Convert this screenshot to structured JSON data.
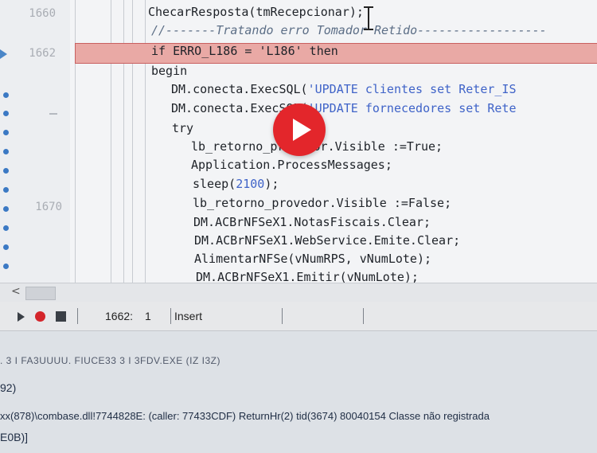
{
  "editor": {
    "gutter_numbers": [
      "1660",
      "1662",
      "1670"
    ],
    "lines": [
      {
        "text": "ChecarResposta(tmRecepcionar);"
      },
      {
        "text": "//-------Tratando erro Tomador Retido------------------"
      },
      {
        "text": "if ERRO_L186 = 'L186' then"
      },
      {
        "text": "begin"
      },
      {
        "prefix": "DM.conecta.ExecSQL(",
        "str": "'UPDATE clientes set Reter_IS"
      },
      {
        "prefix": "DM.conecta.ExecSQL(",
        "str": "'UPDATE fornecedores set Rete"
      },
      {
        "text": "try"
      },
      {
        "text": "lb_retorno_provedor.Visible :=True;"
      },
      {
        "text": "Application.ProcessMessages;"
      },
      {
        "prefix": "sleep(",
        "num": "2100",
        "suffix": ");"
      },
      {
        "text": "lb_retorno_provedor.Visible :=False;"
      },
      {
        "text": "DM.ACBrNFSeX1.NotasFiscais.Clear;"
      },
      {
        "text": "DM.ACBrNFSeX1.WebService.Emite.Clear;"
      },
      {
        "text": "AlimentarNFSe(vNumRPS, vNumLote);"
      },
      {
        "text": "DM.ACBrNFSeX1.Emitir(vNumLote);"
      }
    ]
  },
  "scrollbar": {
    "left_arrow": "<"
  },
  "statusbar": {
    "position": "1662:",
    "column": "1",
    "mode": "Insert"
  },
  "log": {
    "lines": [
      ". 3 I FA3UUUU. FIUCE33 3 I 3FDV.EXE (IZ I3Z)",
      "92)",
      "xx(878)\\combase.dll!7744828E: (caller: 77433CDF) ReturnHr(2) tid(3674) 80040154 Classe não registrada",
      "E0B)]"
    ]
  },
  "video_overlay": {
    "icon": "play-icon",
    "color": "#e3262b"
  }
}
